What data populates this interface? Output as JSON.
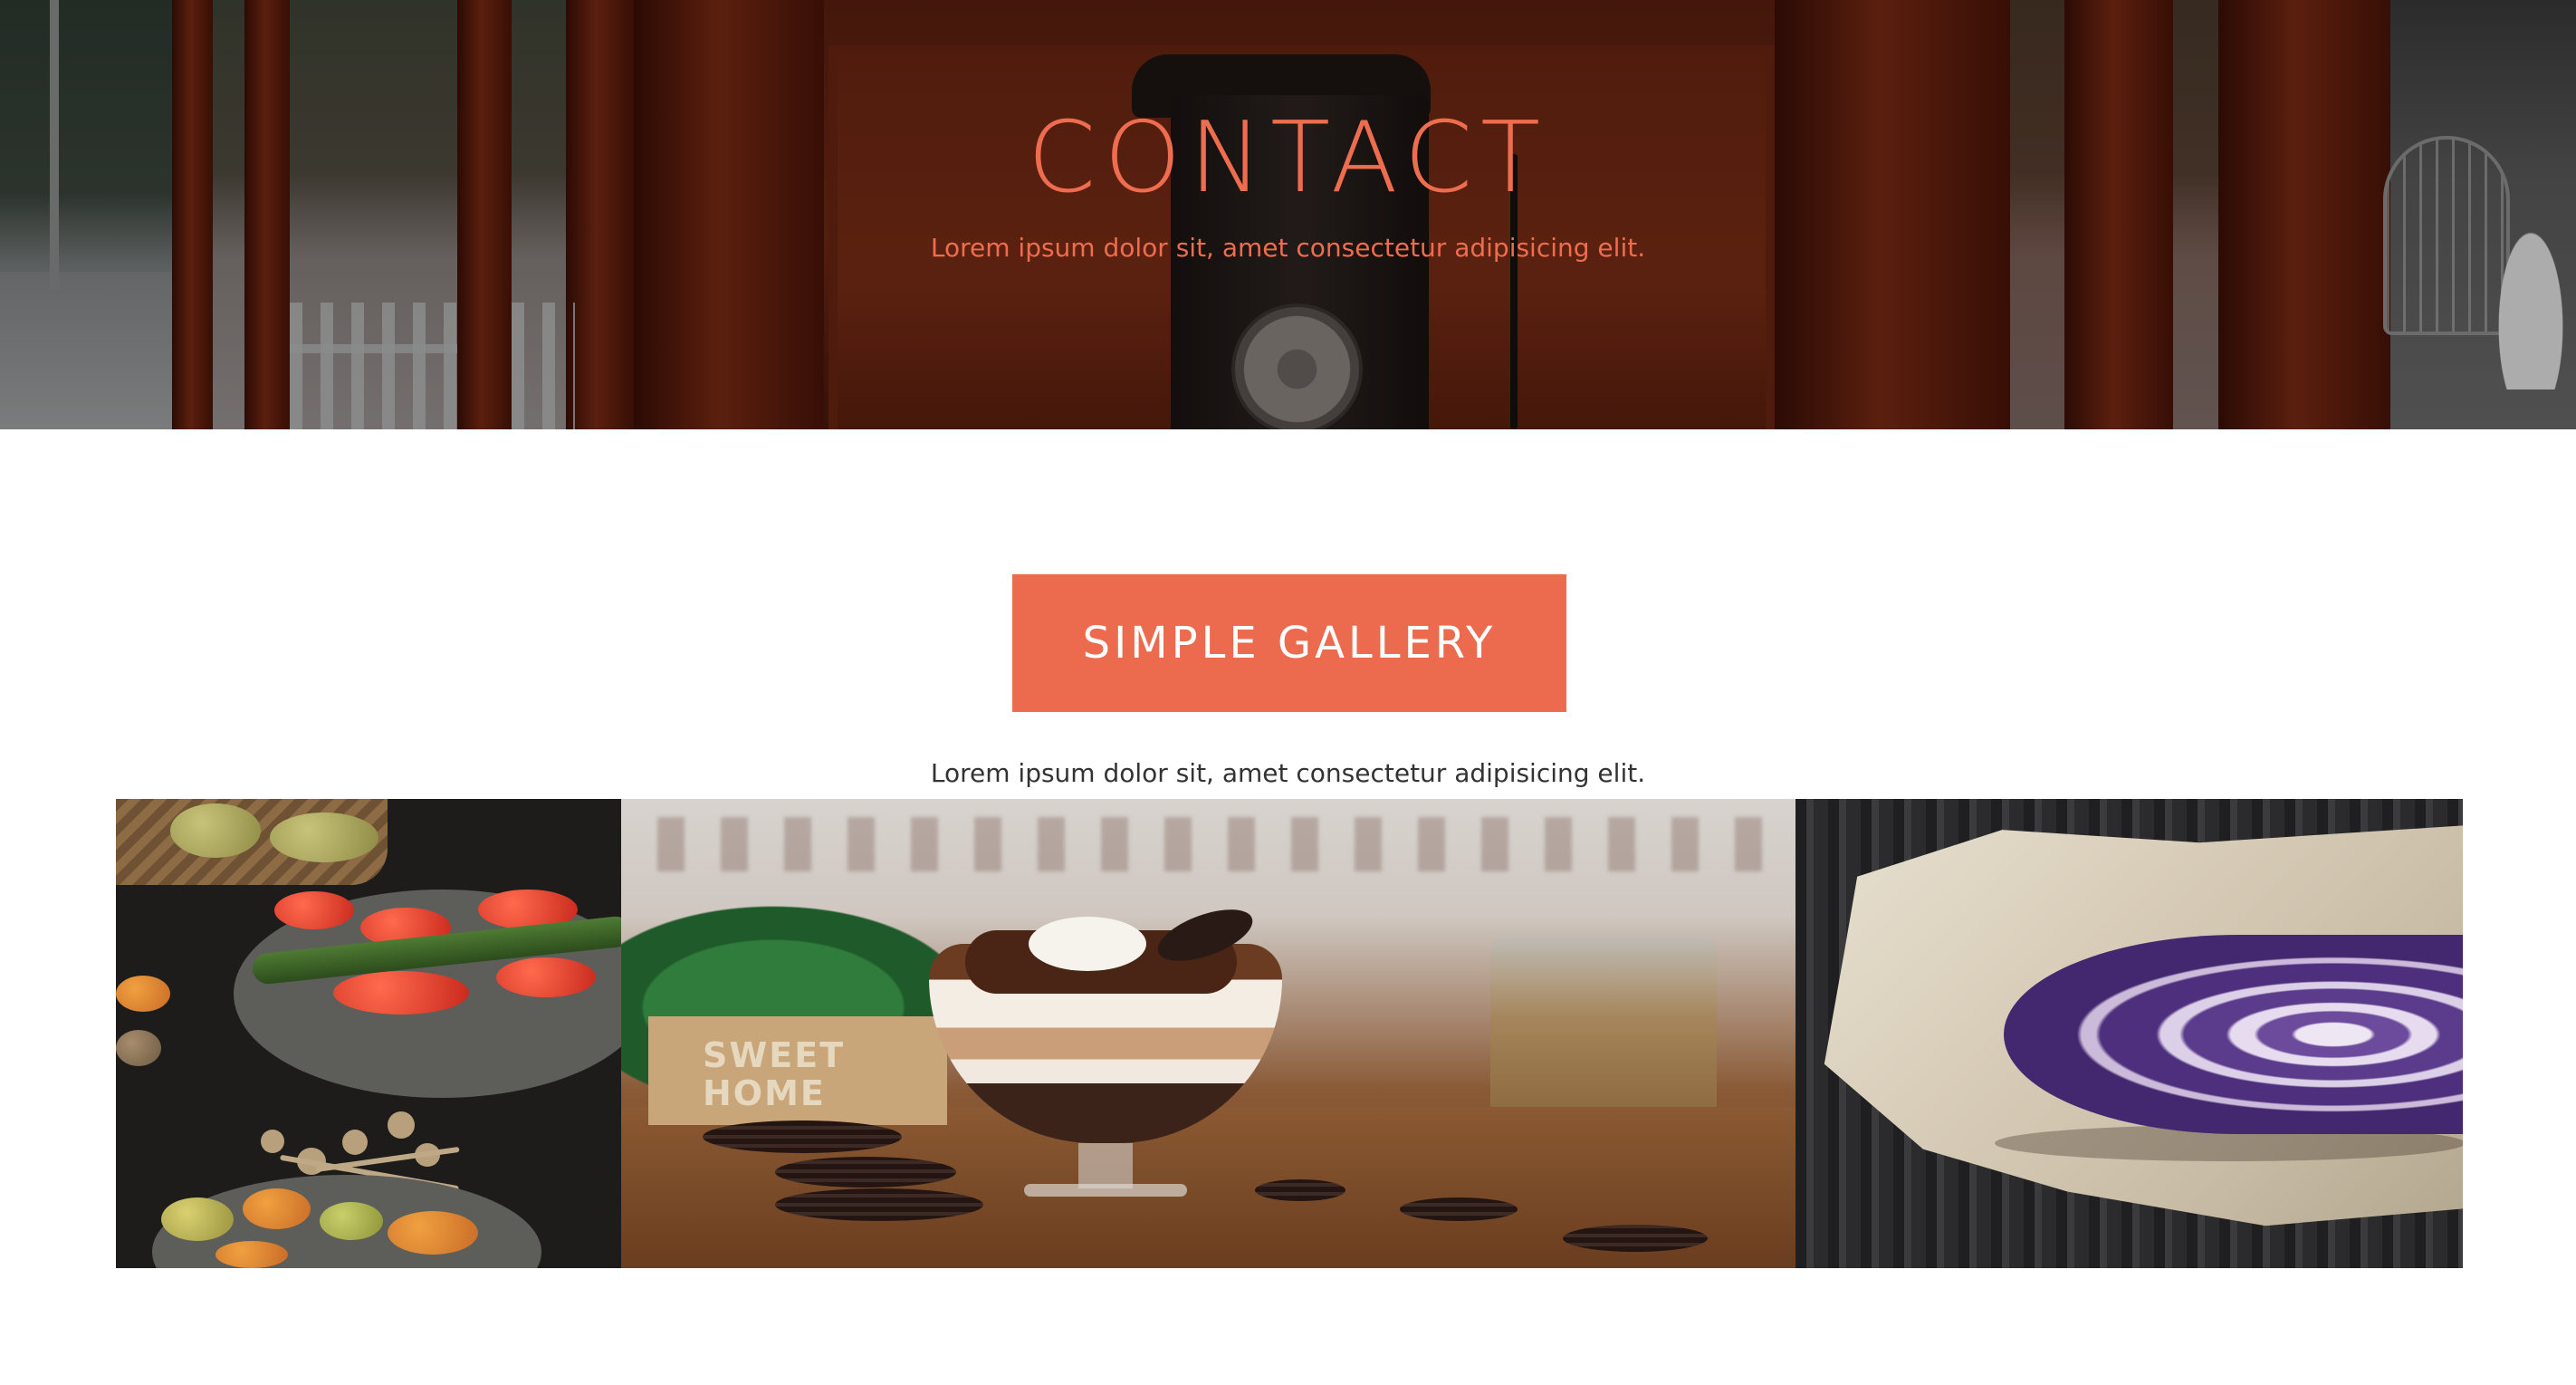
{
  "hero": {
    "title": "CONTACT",
    "subtitle": "Lorem ipsum dolor sit, amet consectetur adipisicing elit."
  },
  "gallery": {
    "button_label": "SIMPLE GALLERY",
    "subtitle": "Lorem ipsum dolor sit, amet consectetur adipisicing elit.",
    "images": [
      {
        "name": "vegetables-photo"
      },
      {
        "name": "dessert-photo",
        "box_text": "SWEET\nHOME"
      },
      {
        "name": "red-cabbage-photo"
      }
    ]
  },
  "colors": {
    "accent": "#ec6b4f",
    "hero_text": "#ef6d4f",
    "body_text": "#333333",
    "background": "#ffffff"
  }
}
